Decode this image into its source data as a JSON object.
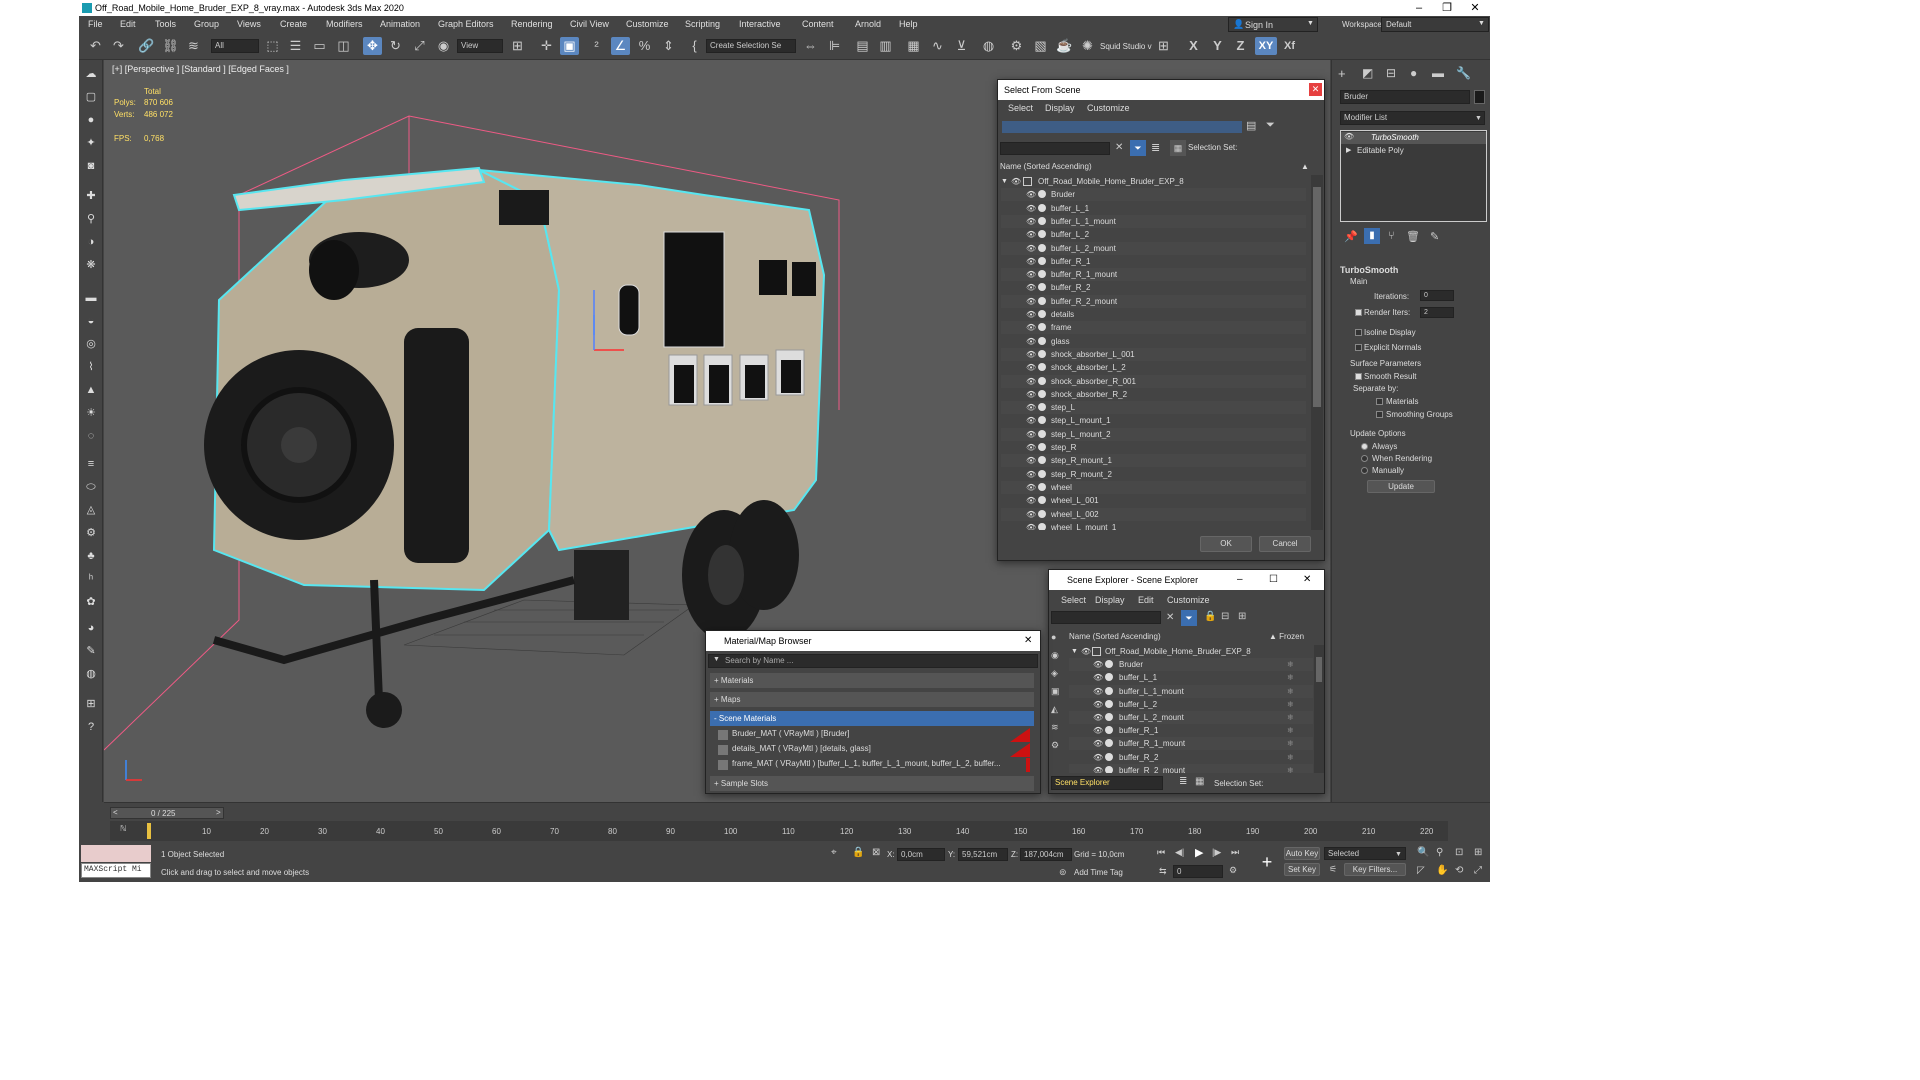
{
  "window": {
    "title": "Off_Road_Mobile_Home_Bruder_EXP_8_vray.max - Autodesk 3ds Max 2020"
  },
  "menu": [
    "File",
    "Edit",
    "Tools",
    "Group",
    "Views",
    "Create",
    "Modifiers",
    "Animation",
    "Graph Editors",
    "Rendering",
    "Civil View",
    "Customize",
    "Scripting",
    "Interactive",
    "Content",
    "Arnold",
    "Help"
  ],
  "signin": {
    "label": "Sign In",
    "workspaces_label": "Workspaces:",
    "workspace": "Default"
  },
  "toolbar": {
    "filter": "All",
    "refcoord": "View",
    "selection_set": "Create Selection Se",
    "squid": "Squid Studio v",
    "axis_x": "X",
    "axis_y": "Y",
    "axis_z": "Z",
    "axis_xy": "XY",
    "axis_xf": "Xf"
  },
  "viewport": {
    "label": "[+] [Perspective ] [Standard ] [Edged Faces ]",
    "stats": {
      "total": "Total",
      "polys_label": "Polys:",
      "polys": "870 606",
      "verts_label": "Verts:",
      "verts": "486 072",
      "fps_label": "FPS:",
      "fps": "0,768"
    }
  },
  "select_from_scene": {
    "title": "Select From Scene",
    "menu": [
      "Select",
      "Display",
      "Customize"
    ],
    "selection_set_label": "Selection Set:",
    "column": "Name (Sorted Ascending)",
    "root": "Off_Road_Mobile_Home_Bruder_EXP_8",
    "items": [
      "Bruder",
      "buffer_L_1",
      "buffer_L_1_mount",
      "buffer_L_2",
      "buffer_L_2_mount",
      "buffer_R_1",
      "buffer_R_1_mount",
      "buffer_R_2",
      "buffer_R_2_mount",
      "details",
      "frame",
      "glass",
      "shock_absorber_L_001",
      "shock_absorber_L_2",
      "shock_absorber_R_001",
      "shock_absorber_R_2",
      "step_L",
      "step_L_mount_1",
      "step_L_mount_2",
      "step_R",
      "step_R_mount_1",
      "step_R_mount_2",
      "wheel",
      "wheel_L_001",
      "wheel_L_002",
      "wheel_L_mount_1"
    ],
    "ok": "OK",
    "cancel": "Cancel"
  },
  "scene_explorer": {
    "title": "Scene Explorer - Scene Explorer",
    "menu": [
      "Select",
      "Display",
      "Edit",
      "Customize"
    ],
    "column": "Name (Sorted Ascending)",
    "frozen": "▲ Frozen",
    "root": "Off_Road_Mobile_Home_Bruder_EXP_8",
    "items": [
      "Bruder",
      "buffer_L_1",
      "buffer_L_1_mount",
      "buffer_L_2",
      "buffer_L_2_mount",
      "buffer_R_1",
      "buffer_R_1_mount",
      "buffer_R_2",
      "buffer_R_2_mount"
    ],
    "footer_name": "Scene Explorer",
    "selection_set_label": "Selection Set:"
  },
  "material_browser": {
    "title": "Material/Map Browser",
    "search_placeholder": "Search by Name ...",
    "sections": {
      "materials": "+ Materials",
      "maps": "+ Maps",
      "scene_materials": "- Scene Materials",
      "sample_slots": "+ Sample Slots"
    },
    "materials": [
      "Bruder_MAT  ( VRayMtl )  [Bruder]",
      "details_MAT  ( VRayMtl )  [details, glass]",
      "frame_MAT  ( VRayMtl )  [buffer_L_1, buffer_L_1_mount, buffer_L_2, buffer..."
    ]
  },
  "command_panel": {
    "object_name": "Bruder",
    "modifier_list": "Modifier List",
    "stack": [
      "TurboSmooth",
      "Editable Poly"
    ],
    "turbosmooth": {
      "title": "TurboSmooth",
      "main": "Main",
      "iterations_label": "Iterations:",
      "iterations": "0",
      "render_iters_label": "Render Iters:",
      "render_iters": "2",
      "isoline": "Isoline Display",
      "explicit": "Explicit Normals",
      "surface_params": "Surface Parameters",
      "smooth_result": "Smooth Result",
      "separate_by": "Separate by:",
      "materials": "Materials",
      "smoothing_groups": "Smoothing Groups",
      "update_options": "Update Options",
      "always": "Always",
      "when_rendering": "When Rendering",
      "manually": "Manually",
      "update": "Update"
    }
  },
  "timeline": {
    "frame": "0 / 225",
    "ticks": [
      "10",
      "20",
      "30",
      "40",
      "50",
      "60",
      "70",
      "80",
      "90",
      "100",
      "110",
      "120",
      "130",
      "140",
      "150",
      "160",
      "170",
      "180",
      "190",
      "200",
      "210",
      "220"
    ]
  },
  "status": {
    "maxscript": "MAXScript Mi",
    "selected": "1 Object Selected",
    "prompt": "Click and drag to select and move objects",
    "x_label": "X:",
    "x": "0,0cm",
    "y_label": "Y:",
    "y": "59,521cm",
    "z_label": "Z:",
    "z": "187,004cm",
    "grid": "Grid = 10,0cm",
    "add_time_tag": "Add Time Tag",
    "autokey": "Auto Key",
    "selected_dd": "Selected",
    "setkey": "Set Key",
    "keyfilters": "Key Filters...",
    "frame_field": "0"
  },
  "colors": {
    "accent": "#3b6eb0",
    "bg": "#444444",
    "viewport": "#5a5a5a",
    "wire": "#4fd8e8",
    "stats": "#ffe066"
  }
}
